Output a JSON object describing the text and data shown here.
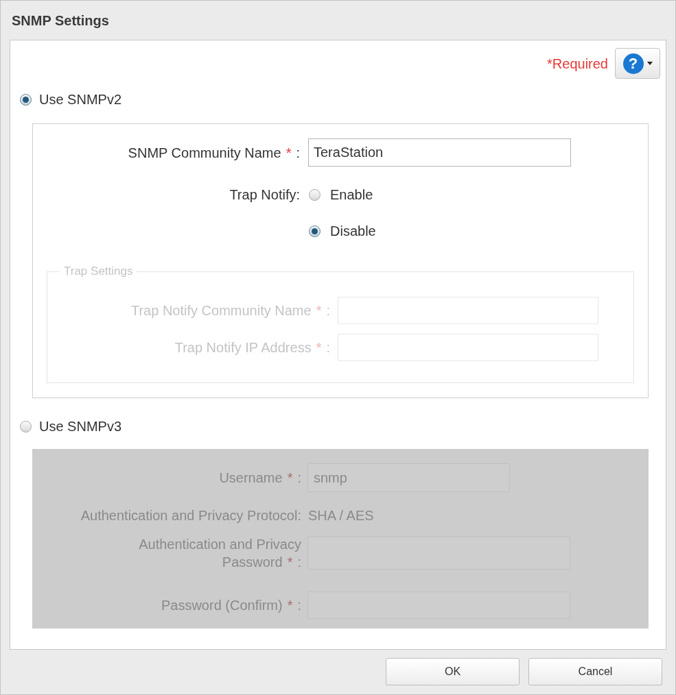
{
  "window": {
    "title": "SNMP Settings"
  },
  "required_note": "*Required",
  "help_button": {
    "label": "?"
  },
  "snmp_modes": [
    {
      "label": "Use SNMPv2",
      "selected": true
    },
    {
      "label": "Use SNMPv3",
      "selected": false
    }
  ],
  "snmpv2": {
    "community_name": {
      "label": "SNMP Community Name",
      "required_mark": "*",
      "separator": ":",
      "value": "TeraStation"
    },
    "trap_notify": {
      "label": "Trap Notify:",
      "options": [
        {
          "label": "Enable",
          "selected": false
        },
        {
          "label": "Disable",
          "selected": true
        }
      ]
    },
    "trap_settings": {
      "legend": "Trap Settings",
      "disabled": true,
      "fields": [
        {
          "label": "Trap Notify Community Name",
          "required_mark": "*",
          "separator": ":"
        },
        {
          "label": "Trap Notify IP Address",
          "required_mark": "*",
          "separator": ":"
        }
      ]
    }
  },
  "snmpv3": {
    "disabled": true,
    "rows": [
      {
        "kind": "field",
        "label": "Username",
        "required_mark": "*",
        "separator": ":",
        "value": "snmp"
      },
      {
        "kind": "text",
        "label": "Authentication and Privacy Protocol:",
        "value": "SHA / AES"
      },
      {
        "kind": "field",
        "label": "Authentication and Privacy Password",
        "required_mark": "*",
        "separator": ":"
      },
      {
        "kind": "field",
        "label": "Password (Confirm)",
        "required_mark": "*",
        "separator": ":"
      }
    ]
  },
  "buttons": [
    {
      "label": "OK"
    },
    {
      "label": "Cancel"
    }
  ]
}
